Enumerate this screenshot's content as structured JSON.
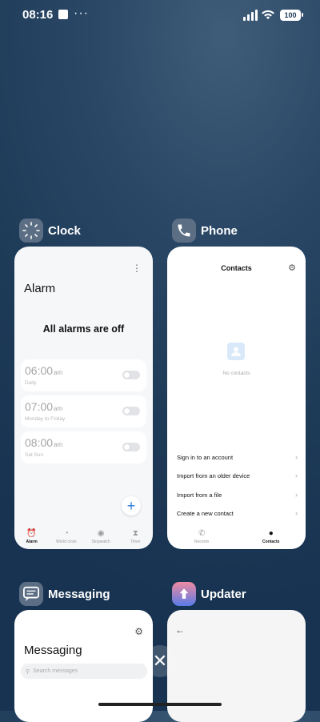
{
  "status_bar": {
    "time": "08:16",
    "more": "···",
    "battery": "100"
  },
  "apps": {
    "clock": {
      "title": "Clock",
      "icon": "clock-icon",
      "screen_title": "Alarm",
      "empty_text": "All alarms are off",
      "alarms": [
        {
          "time": "06:00",
          "ampm": "am",
          "repeat": "Daily"
        },
        {
          "time": "07:00",
          "ampm": "am",
          "repeat": "Monday to Friday"
        },
        {
          "time": "08:00",
          "ampm": "am",
          "repeat": "Sat Sun"
        }
      ],
      "nav": [
        {
          "label": "Alarm",
          "icon": "alarm-icon",
          "active": true
        },
        {
          "label": "World clock",
          "icon": "world-clock-icon",
          "active": false
        },
        {
          "label": "Stopwatch",
          "icon": "stopwatch-icon",
          "active": false
        },
        {
          "label": "Timer",
          "icon": "timer-icon",
          "active": false
        }
      ]
    },
    "phone": {
      "title": "Phone",
      "icon": "phone-icon",
      "screen_title": "Contacts",
      "empty_text": "No contacts",
      "options": [
        "Sign in to an account",
        "Import from an older device",
        "Import from a file",
        "Create a new contact"
      ],
      "nav": [
        {
          "label": "Recents",
          "icon": "phone-icon",
          "active": false
        },
        {
          "label": "Contacts",
          "icon": "person-icon",
          "active": true
        }
      ]
    },
    "messaging": {
      "title": "Messaging",
      "icon": "message-icon",
      "screen_title": "Messaging",
      "search_placeholder": "Search messages"
    },
    "updater": {
      "title": "Updater",
      "icon": "updater-icon"
    }
  },
  "colors": {
    "accent": "#2a7ad6",
    "background": "#1d3a57"
  }
}
